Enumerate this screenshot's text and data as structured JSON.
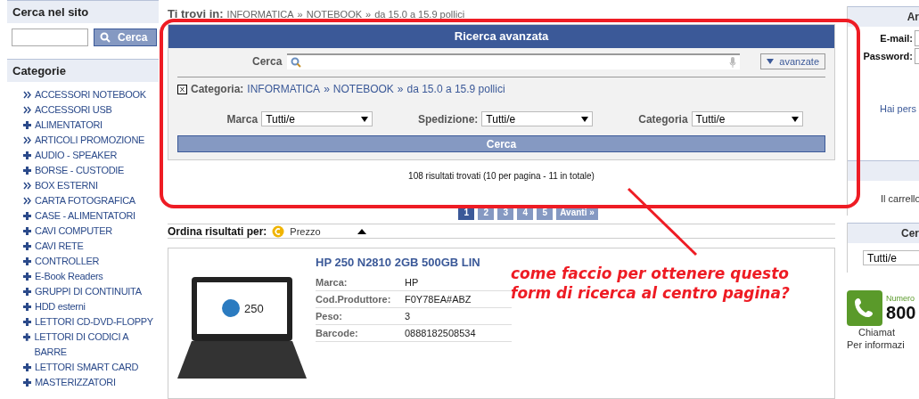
{
  "site_search": {
    "title": "Cerca nel sito",
    "button": "Cerca"
  },
  "categories": {
    "title": "Categorie",
    "items": [
      {
        "label": "ACCESSORI NOTEBOOK",
        "kind": "link"
      },
      {
        "label": "ACCESSORI USB",
        "kind": "link"
      },
      {
        "label": "ALIMENTATORI",
        "kind": "expand"
      },
      {
        "label": "ARTICOLI PROMOZIONE",
        "kind": "link"
      },
      {
        "label": "AUDIO - SPEAKER",
        "kind": "expand"
      },
      {
        "label": "BORSE - CUSTODIE",
        "kind": "expand"
      },
      {
        "label": "BOX ESTERNI",
        "kind": "link"
      },
      {
        "label": "CARTA FOTOGRAFICA",
        "kind": "link"
      },
      {
        "label": "CASE - ALIMENTATORI",
        "kind": "expand"
      },
      {
        "label": "CAVI COMPUTER",
        "kind": "expand"
      },
      {
        "label": "CAVI RETE",
        "kind": "expand"
      },
      {
        "label": "CONTROLLER",
        "kind": "expand"
      },
      {
        "label": "E-Book Readers",
        "kind": "expand"
      },
      {
        "label": "GRUPPI DI CONTINUITA",
        "kind": "expand"
      },
      {
        "label": "HDD esterni",
        "kind": "expand"
      },
      {
        "label": "LETTORI CD-DVD-FLOPPY",
        "kind": "expand"
      },
      {
        "label": "LETTORI DI CODICI A BARRE",
        "kind": "expand"
      },
      {
        "label": "LETTORI SMART CARD",
        "kind": "expand"
      },
      {
        "label": "MASTERIZZATORI",
        "kind": "expand"
      }
    ]
  },
  "breadcrumb": {
    "label": "Ti trovi in:",
    "path": [
      "INFORMATICA",
      "NOTEBOOK",
      "da 15.0 a 15.9 pollici"
    ],
    "separator": "»"
  },
  "advanced_search": {
    "title": "Ricerca avanzata",
    "search_label": "Cerca",
    "toggle": "avanzate",
    "category_filter": {
      "label": "Categoria:",
      "path": [
        "INFORMATICA",
        "NOTEBOOK",
        "da 15.0 a 15.9 pollici"
      ],
      "remove": "X"
    },
    "filters": [
      {
        "label": "Marca",
        "value": "Tutti/e"
      },
      {
        "label": "Spedizione:",
        "value": "Tutti/e"
      },
      {
        "label": "Categoria",
        "value": "Tutti/e"
      }
    ],
    "submit": "Cerca"
  },
  "results_summary": "108 risultati trovati (10 per pagina - 11 in totale)",
  "pagination": [
    {
      "label": "1",
      "selected": true
    },
    {
      "label": "2",
      "selected": false
    },
    {
      "label": "3",
      "selected": false
    },
    {
      "label": "4",
      "selected": false
    },
    {
      "label": "5",
      "selected": false
    },
    {
      "label": "Avanti »",
      "selected": false
    }
  ],
  "sort": {
    "label": "Ordina risultati per:",
    "option": "Prezzo"
  },
  "product": {
    "title": "HP 250 N2810 2GB 500GB LIN",
    "screen_text": "250",
    "specs": [
      {
        "name": "Marca:",
        "value": "HP"
      },
      {
        "name": "Cod.Produttore:",
        "value": "F0Y78EA#ABZ"
      },
      {
        "name": "Peso:",
        "value": "3"
      },
      {
        "name": "Barcode:",
        "value": "0888182508534"
      }
    ]
  },
  "right_column": {
    "login": {
      "title": "Ar",
      "fields": [
        "E-mail:",
        "Password:"
      ],
      "link": "Hai pers"
    },
    "cart": {
      "text": "Il carrello"
    },
    "search": {
      "title": "Cer",
      "value": "Tutti/e"
    },
    "phone": {
      "label": "Numero",
      "number": "800",
      "lines": [
        "Chiamat",
        "Per informazi"
      ]
    }
  },
  "annotation": {
    "text": "come faccio per ottenere questo form di ricerca al centro pagina?"
  }
}
